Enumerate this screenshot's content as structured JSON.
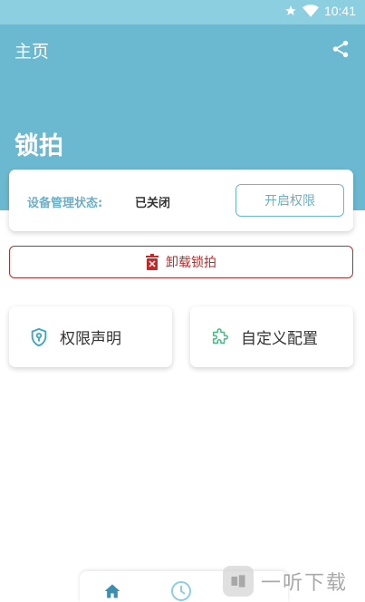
{
  "statusbar": {
    "time": "10:41",
    "icons": [
      "star-icon",
      "wifi-icon"
    ]
  },
  "header": {
    "title": "主页",
    "app_title": "锁拍",
    "share_icon": "share-icon"
  },
  "status_card": {
    "label": "设备管理状态:",
    "value": "已关闭",
    "enable_button": "开启权限"
  },
  "uninstall": {
    "label": "卸载锁拍",
    "icon": "trash-icon"
  },
  "tiles": [
    {
      "label": "权限声明",
      "icon": "shield-key-icon"
    },
    {
      "label": "自定义配置",
      "icon": "puzzle-icon"
    }
  ],
  "bottom_nav": [
    "home-icon",
    "clock-icon"
  ],
  "colors": {
    "primary": "#6bb9d1",
    "danger": "#c62828",
    "status_bar": "#8ccfe0"
  }
}
